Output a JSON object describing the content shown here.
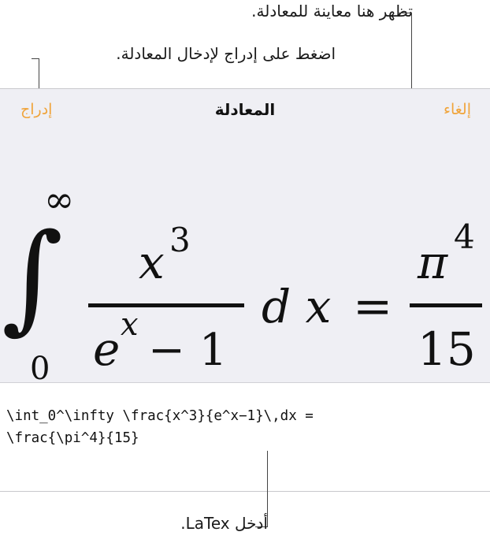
{
  "callouts": {
    "preview": "تظهر هنا معاينة للمعادلة.",
    "insert": "اضغط على إدراج لإدخال المعادلة.",
    "latex": "أدخل LaTex."
  },
  "dialog": {
    "title": "المعادلة",
    "insert_label": "إدراج",
    "cancel_label": "إلغاء",
    "accent_color": "#f0a43a"
  },
  "preview": {
    "integral_sign": "∫",
    "lower_limit": "0",
    "upper_limit": "∞",
    "numerator_base": "x",
    "numerator_exp": "3",
    "denominator_base": "e",
    "denominator_exp": "x",
    "denominator_tail": "− 1",
    "differential": "d x",
    "equals": "=",
    "rhs_numerator_base": "π",
    "rhs_numerator_exp": "4",
    "rhs_denominator": "15"
  },
  "editor": {
    "latex_line1": "\\int_0^\\infty \\frac{x^3}{e^x−1}\\,dx =",
    "latex_line2": "\\frac{\\pi^4}{15}"
  }
}
